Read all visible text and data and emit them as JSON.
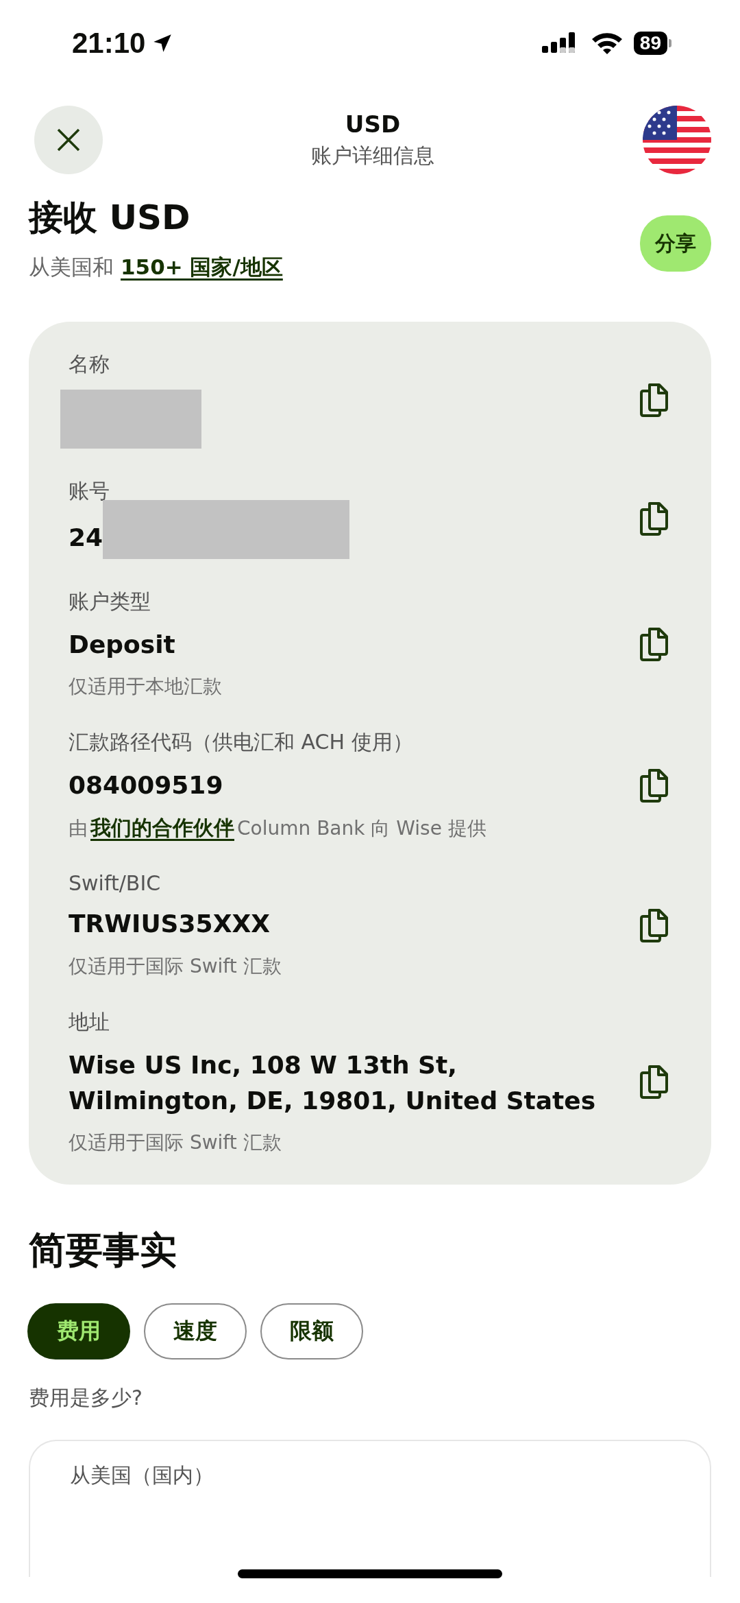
{
  "status_bar": {
    "time": "21:10",
    "battery": "89"
  },
  "header": {
    "title": "USD",
    "subtitle": "账户详细信息"
  },
  "intro": {
    "title": "接收 USD",
    "lead": "从美国和",
    "link": "150+ 国家/地区",
    "share": "分享"
  },
  "fields": [
    {
      "label": "名称",
      "kind": "masked"
    },
    {
      "label": "账号",
      "kind": "partial",
      "value": "24"
    },
    {
      "label": "账户类型",
      "kind": "plain",
      "value": "Deposit",
      "note": {
        "text": "仅适用于本地汇款"
      }
    },
    {
      "label": "汇款路径代码（供电汇和 ACH 使用）",
      "kind": "plain",
      "value": "084009519",
      "note": {
        "prefix": "由",
        "link": "我们的合作伙伴",
        "suffix": "Column Bank 向 Wise 提供"
      }
    },
    {
      "label": "Swift/BIC",
      "kind": "plain",
      "value": "TRWIUS35XXX",
      "note": {
        "text": "仅适用于国际 Swift 汇款"
      }
    },
    {
      "label": "地址",
      "kind": "plain",
      "value": "Wise US Inc, 108 W 13th St, Wilmington, DE, 19801, United States",
      "note": {
        "text": "仅适用于国际 Swift 汇款"
      }
    }
  ],
  "facts": {
    "title": "简要事实",
    "tabs": [
      {
        "label": "费用",
        "selected": true
      },
      {
        "label": "速度",
        "selected": false
      },
      {
        "label": "限额",
        "selected": false
      }
    ],
    "question": "费用是多少?",
    "card_heading": "从美国（国内）"
  }
}
